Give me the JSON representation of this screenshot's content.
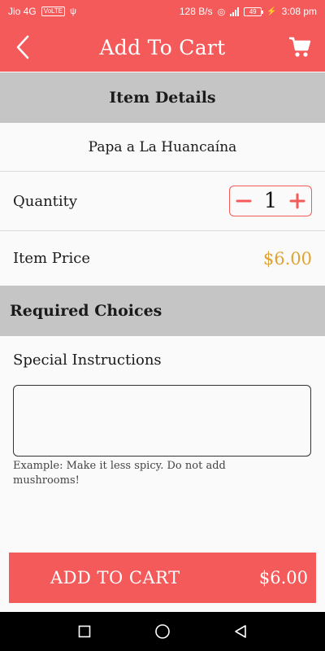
{
  "status_bar": {
    "carrier": "Jio 4G",
    "volte": "VoLTE",
    "net_speed": "128 B/s",
    "battery": "49",
    "time": "3:08 pm"
  },
  "app_bar": {
    "title": "Add To Cart",
    "back_icon": "back-chevron-icon",
    "cart_icon": "shopping-cart-icon"
  },
  "item_details": {
    "header": "Item Details",
    "item_name": "Papa a La Huancaína",
    "quantity_label": "Quantity",
    "quantity_value": "1",
    "price_label": "Item Price",
    "price_value": "$6.00"
  },
  "required_choices": {
    "header": "Required Choices"
  },
  "special_instructions": {
    "label": "Special Instructions",
    "value": "",
    "hint": "Example: Make it less spicy. Do not add mushrooms!"
  },
  "add_to_cart": {
    "label": "ADD TO CART",
    "total": "$6.00"
  },
  "colors": {
    "accent": "#f45a5a",
    "price": "#e0a233",
    "section_bg": "#c5c5c5"
  }
}
